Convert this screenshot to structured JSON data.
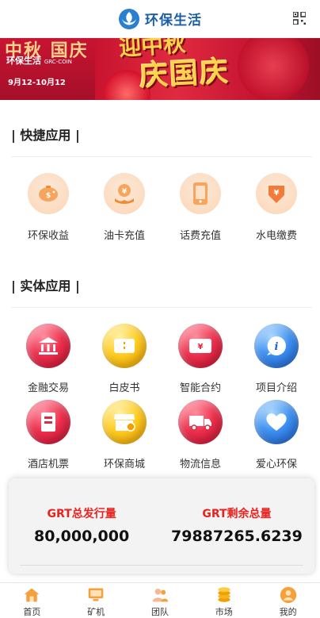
{
  "header": {
    "brand": "环保生活"
  },
  "banner": {
    "left_brand": "环保生活",
    "left_brand_sub": "GRC-COIN",
    "date_range": "9月12-10月12",
    "title_top": "迎中秋",
    "title_main": "庆国庆"
  },
  "quick": {
    "title": "| 快捷应用 |",
    "items": [
      {
        "label": "环保收益",
        "icon": "piggy-bank-icon"
      },
      {
        "label": "油卡充值",
        "icon": "coin-hand-icon"
      },
      {
        "label": "话费充值",
        "icon": "phone-icon"
      },
      {
        "label": "水电缴费",
        "icon": "bill-icon"
      }
    ]
  },
  "apps": {
    "title": "| 实体应用 |",
    "items": [
      {
        "label": "金融交易",
        "icon": "bank-icon",
        "color": "red"
      },
      {
        "label": "白皮书",
        "icon": "ticket-icon",
        "color": "yellow"
      },
      {
        "label": "智能合约",
        "icon": "yen-ticket-icon",
        "color": "red"
      },
      {
        "label": "项目介绍",
        "icon": "info-icon",
        "color": "blue"
      },
      {
        "label": "酒店机票",
        "icon": "hotel-icon",
        "color": "red"
      },
      {
        "label": "环保商城",
        "icon": "shop-icon",
        "color": "yellow"
      },
      {
        "label": "物流信息",
        "icon": "truck-icon",
        "color": "red"
      },
      {
        "label": "爱心环保",
        "icon": "heart-icon",
        "color": "blue"
      }
    ]
  },
  "stats": {
    "issued_label": "GRT总发行量",
    "issued_value": "80,000,000",
    "remaining_label": "GRT剩余总量",
    "remaining_value": "79887265.6239"
  },
  "nav": {
    "items": [
      {
        "label": "首页",
        "icon": "home-icon"
      },
      {
        "label": "矿机",
        "icon": "monitor-icon"
      },
      {
        "label": "团队",
        "icon": "team-icon"
      },
      {
        "label": "市场",
        "icon": "coins-icon"
      },
      {
        "label": "我的",
        "icon": "user-icon"
      }
    ]
  },
  "colors": {
    "brand": "#1a5fa6",
    "accent": "#e8231f",
    "quick_bg": "#fbd5b6"
  }
}
